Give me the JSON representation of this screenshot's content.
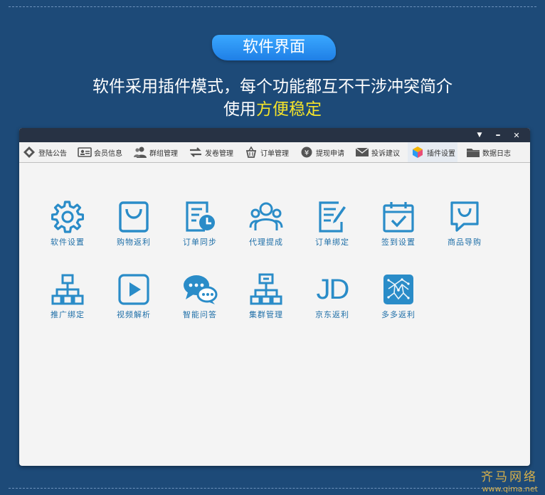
{
  "section_badge": "软件界面",
  "headline_line1": "软件采用插件模式，每个功能都互不干涉冲突简介",
  "headline_line2_prefix": "使用",
  "headline_line2_highlight": "方便稳定",
  "window_controls": {
    "menu": "▼",
    "minimize": "–",
    "close": "✕"
  },
  "toolbar": [
    {
      "label": "登陆公告",
      "icon": "login-notice-icon"
    },
    {
      "label": "会员信息",
      "icon": "member-card-icon"
    },
    {
      "label": "群组管理",
      "icon": "group-users-icon"
    },
    {
      "label": "发卷管理",
      "icon": "coupon-exchange-icon"
    },
    {
      "label": "订单管理",
      "icon": "basket-icon"
    },
    {
      "label": "提现申请",
      "icon": "withdraw-coin-icon"
    },
    {
      "label": "投诉建议",
      "icon": "mail-icon"
    },
    {
      "label": "插件设置",
      "icon": "plugin-cube-icon"
    },
    {
      "label": "数据日志",
      "icon": "folder-log-icon"
    }
  ],
  "plugins": [
    {
      "label": "软件设置",
      "icon": "gear-icon"
    },
    {
      "label": "购物返利",
      "icon": "shopping-bag-icon"
    },
    {
      "label": "订单同步",
      "icon": "order-clock-icon"
    },
    {
      "label": "代理提成",
      "icon": "agent-users-icon"
    },
    {
      "label": "订单绑定",
      "icon": "order-edit-icon"
    },
    {
      "label": "签到设置",
      "icon": "calendar-check-icon"
    },
    {
      "label": "商品导购",
      "icon": "product-guide-icon"
    },
    {
      "label": "推广绑定",
      "icon": "hierarchy-icon"
    },
    {
      "label": "视频解析",
      "icon": "video-play-icon"
    },
    {
      "label": "智能问答",
      "icon": "chat-bubbles-icon"
    },
    {
      "label": "集群管理",
      "icon": "cluster-network-icon"
    },
    {
      "label": "京东返利",
      "icon": "jd-logo-icon",
      "logo_text": "JD"
    },
    {
      "label": "多多返利",
      "icon": "duoduo-qr-icon"
    }
  ],
  "watermark": {
    "name": "齐马网络",
    "url": "www.qima.net"
  },
  "colors": {
    "background": "#1d4a78",
    "accent": "#2a8cc8",
    "highlight": "#f4e32a"
  }
}
